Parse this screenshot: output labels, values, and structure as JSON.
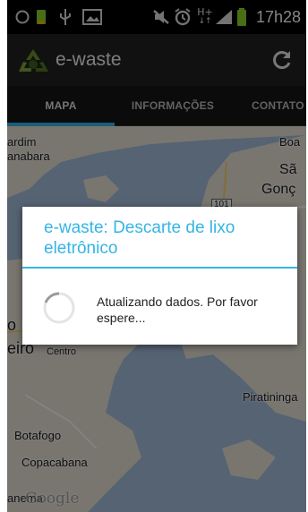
{
  "status_bar": {
    "icons": [
      "ring-icon",
      "battery-saver-icon",
      "usb-icon",
      "picture-icon",
      "mute-icon",
      "alarm-icon",
      "hspa-icon",
      "signal-icon",
      "battery-icon"
    ],
    "time": "17h28",
    "hspa_label": "H+"
  },
  "action_bar": {
    "title": "e-waste",
    "refresh_icon": "refresh-icon",
    "logo_icon": "recycle-logo-icon"
  },
  "tabs": [
    {
      "label": "MAPA",
      "selected": true
    },
    {
      "label": "INFORMAÇÕES",
      "selected": false
    },
    {
      "label": "CONTATO",
      "selected": false
    }
  ],
  "map": {
    "labels": {
      "jardim": "ardim",
      "guanabara": "anabara",
      "boa": "Boa",
      "sao": "Sã",
      "goncalo": "Gonç",
      "route": "101",
      "centro": "Centro",
      "rio": "eiro",
      "o": "o",
      "piratininga": "Piratininga",
      "botafogo": "Botafogo",
      "copacabana": "Copacabana",
      "ipanema": "anema",
      "google": "Google"
    }
  },
  "dialog": {
    "title": "e-waste: Descarte de lixo eletrônico",
    "message": "Atualizando dados. Por favor espere...",
    "accent": "#33b5e5"
  },
  "colors": {
    "accent": "#33b5e5",
    "water": "#a5bfdd",
    "land": "#e8e3d6"
  }
}
